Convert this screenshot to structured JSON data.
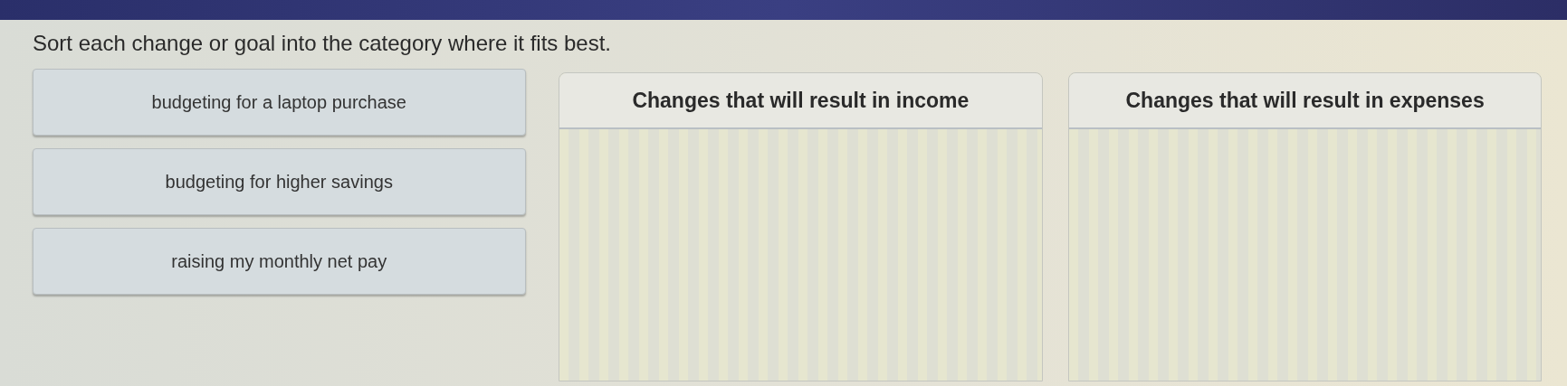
{
  "prompt": "Sort each change or goal into the category where it fits best.",
  "items": [
    {
      "label": "budgeting for a laptop purchase"
    },
    {
      "label": "budgeting for higher savings"
    },
    {
      "label": "raising my monthly net pay"
    }
  ],
  "categories": [
    {
      "title": "Changes that will result in income"
    },
    {
      "title": "Changes that will result in expenses"
    }
  ]
}
